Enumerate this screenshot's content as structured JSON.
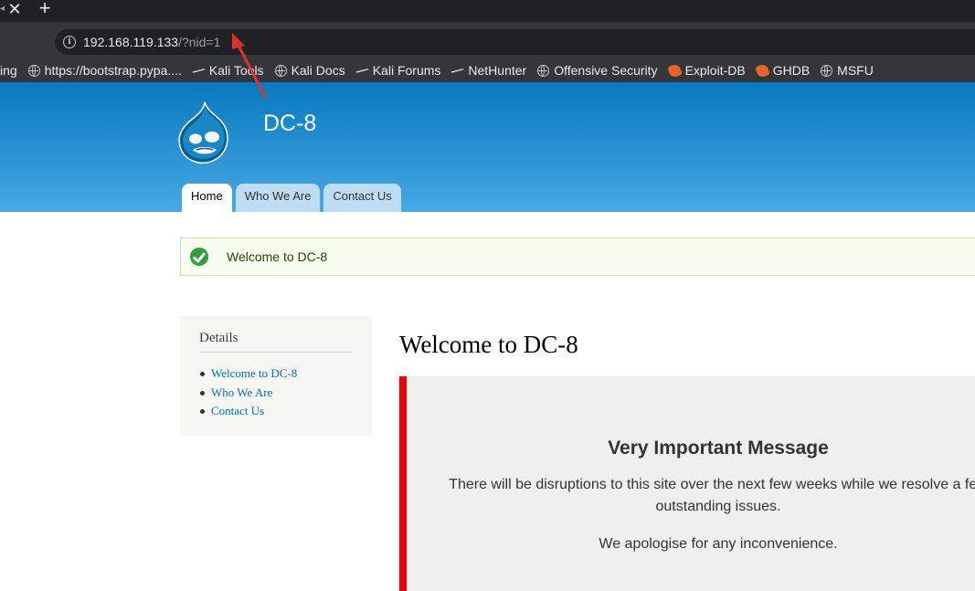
{
  "browser": {
    "tab": {
      "close_glyph": "✕",
      "new_tab_glyph": "+",
      "edge_glyph": "◂"
    },
    "address": {
      "host": "192.168.119.133",
      "path": "/?nid=1"
    },
    "bookmarks": [
      {
        "label": "ing",
        "icon": "none"
      },
      {
        "label": "https://bootstrap.pypa....",
        "icon": "globe-icon"
      },
      {
        "label": "Kali Tools",
        "icon": "kali-dragon-icon"
      },
      {
        "label": "Kali Docs",
        "icon": "globe-icon"
      },
      {
        "label": "Kali Forums",
        "icon": "kali-dragon-icon"
      },
      {
        "label": "NetHunter",
        "icon": "kali-dragon-icon"
      },
      {
        "label": "Offensive Security",
        "icon": "globe-icon"
      },
      {
        "label": "Exploit-DB",
        "icon": "exploit-db-icon"
      },
      {
        "label": "GHDB",
        "icon": "exploit-db-icon"
      },
      {
        "label": "MSFU",
        "icon": "globe-icon"
      }
    ]
  },
  "site": {
    "name": "DC-8",
    "tabs": [
      {
        "label": "Home",
        "active": true
      },
      {
        "label": "Who We Are",
        "active": false
      },
      {
        "label": "Contact Us",
        "active": false
      }
    ]
  },
  "status_message": "Welcome to DC-8",
  "sidebar": {
    "title": "Details",
    "links": [
      "Welcome to DC-8",
      "Who We Are",
      "Contact Us"
    ]
  },
  "main": {
    "title": "Welcome to DC-8",
    "message_heading": "Very Important Message",
    "message_paragraph_1": "There will be disruptions to this site over the next few weeks while we resolve a few outstanding issues.",
    "message_paragraph_2": "We apologise for any inconvenience."
  },
  "colors": {
    "header_top": "#0779bf",
    "header_bottom": "#48a9e4",
    "accent_red": "#ee0000",
    "link_blue": "#0071b3",
    "status_green": "#2f9f39"
  }
}
